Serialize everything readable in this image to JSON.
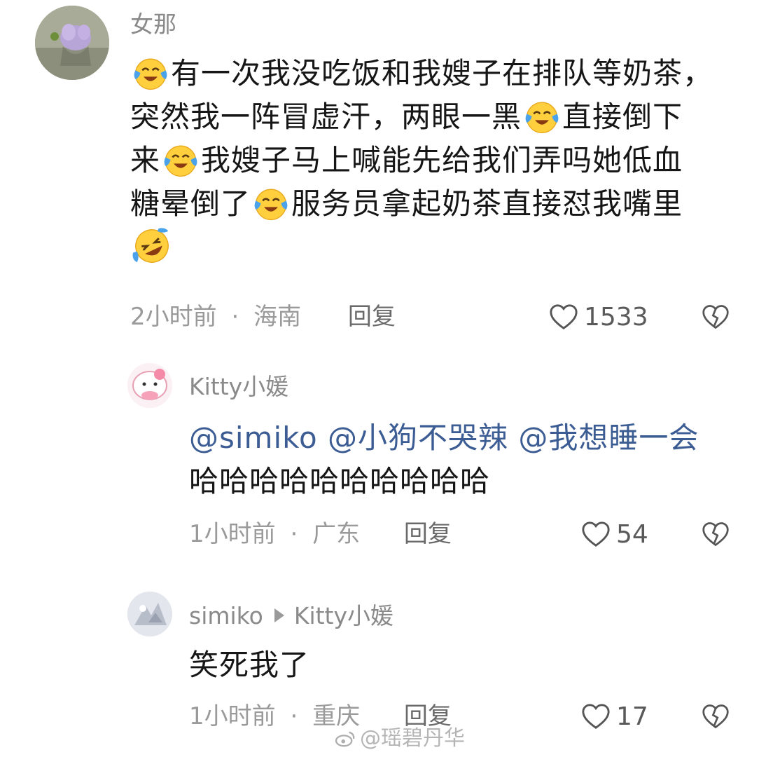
{
  "comments": [
    {
      "username": "女那",
      "text_lines": [
        [
          "有一次我没吃饭和我嫂子在排队等奶茶，"
        ],
        [
          "突然我一阵冒虚汗，两眼一黑",
          "直接倒下"
        ],
        [
          "来",
          "我嫂子马上喊能先给我们弄吗她低血"
        ],
        [
          "糖晕倒了",
          "服务员拿起奶茶直接怼我嘴里"
        ]
      ],
      "time": "2小时前",
      "location": "海南",
      "reply_label": "回复",
      "likes": "1533"
    },
    {
      "username": "Kitty小媛",
      "mentions": "@simiko @小狗不哭辣 @我想睡一会",
      "text": "哈哈哈哈哈哈哈哈哈哈",
      "time": "1小时前",
      "location": "广东",
      "reply_label": "回复",
      "likes": "54"
    },
    {
      "username": "simiko",
      "reply_to": "Kitty小媛",
      "text": "笑死我了",
      "time": "1小时前",
      "location": "重庆",
      "reply_label": "回复",
      "likes": "17"
    }
  ],
  "separator": "·",
  "watermark": "@瑶碧丹华",
  "colors": {
    "mention": "#3c5c94",
    "meta": "#9a9a9a",
    "emoji_yellow": "#ffcf3e",
    "tear_blue": "#4aa3ea"
  },
  "icons": [
    "heart-icon",
    "broken-heart-icon",
    "crying-laughing-emoji",
    "rolling-laughing-emoji",
    "weibo-icon"
  ]
}
